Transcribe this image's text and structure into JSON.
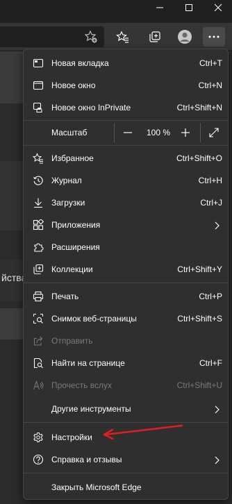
{
  "window": {
    "controls": [
      "minimize-icon",
      "maximize-icon",
      "close-icon"
    ]
  },
  "toolbar": {
    "icons": [
      "favorites-add-icon",
      "favorites-icon",
      "collections-icon",
      "profile-icon",
      "more-icon"
    ]
  },
  "page": {
    "partial_text": "йства"
  },
  "menu": {
    "new_tab": {
      "label": "Новая вкладка",
      "shortcut": "Ctrl+T"
    },
    "new_window": {
      "label": "Новое окно",
      "shortcut": "Ctrl+N"
    },
    "new_inprivate": {
      "label": "Новое окно InPrivate",
      "shortcut": "Ctrl+Shift+N"
    },
    "zoom": {
      "label": "Масштаб",
      "value": "100 %",
      "minus": "—",
      "plus": "+"
    },
    "favorites": {
      "label": "Избранное",
      "shortcut": "Ctrl+Shift+O"
    },
    "history": {
      "label": "Журнал",
      "shortcut": "Ctrl+H"
    },
    "downloads": {
      "label": "Загрузки",
      "shortcut": "Ctrl+J"
    },
    "apps": {
      "label": "Приложения"
    },
    "extensions": {
      "label": "Расширения"
    },
    "collections": {
      "label": "Коллекции",
      "shortcut": "Ctrl+Shift+Y"
    },
    "print": {
      "label": "Печать",
      "shortcut": "Ctrl+P"
    },
    "screenshot": {
      "label": "Снимок веб-страницы",
      "shortcut": "Ctrl+Shift+S"
    },
    "share": {
      "label": "Отправить"
    },
    "find": {
      "label": "Найти на странице",
      "shortcut": "Ctrl+F"
    },
    "read_aloud": {
      "label": "Прочесть вслух",
      "shortcut": "Ctrl+Shift+U"
    },
    "more_tools": {
      "label": "Другие инструменты"
    },
    "settings": {
      "label": "Настройки"
    },
    "help": {
      "label": "Справка и отзывы"
    },
    "close_edge": {
      "label": "Закрыть Microsoft Edge"
    }
  },
  "colors": {
    "menu_bg": "#2f2f2f",
    "text": "#ffffff",
    "disabled_text": "#7a7a7a",
    "annotation_arrow": "#e02020"
  }
}
